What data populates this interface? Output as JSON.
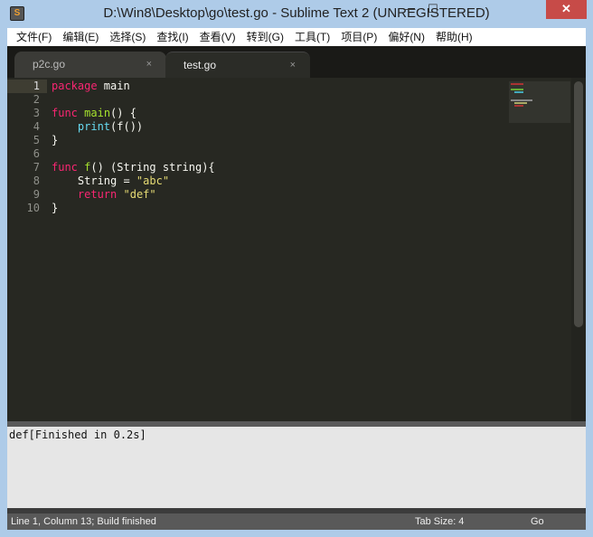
{
  "window": {
    "title": "D:\\Win8\\Desktop\\go\\test.go - Sublime Text 2 (UNREGISTERED)",
    "app_icon": "S",
    "minimize": "—",
    "maximize": "☐",
    "close": "✕"
  },
  "menu": [
    "文件(F)",
    "编辑(E)",
    "选择(S)",
    "查找(I)",
    "查看(V)",
    "转到(G)",
    "工具(T)",
    "项目(P)",
    "偏好(N)",
    "帮助(H)"
  ],
  "tabs": [
    {
      "label": "p2c.go",
      "close": "×"
    },
    {
      "label": "test.go",
      "close": "×"
    }
  ],
  "code": {
    "line_numbers": [
      "1",
      "2",
      "3",
      "4",
      "5",
      "6",
      "7",
      "8",
      "9",
      "10"
    ]
  },
  "output": {
    "text": "def[Finished in 0.2s]"
  },
  "status": {
    "position": "Line 1, Column 13; Build finished",
    "tab_size": "Tab Size: 4",
    "syntax": "Go"
  },
  "colors": {
    "keyword": "#f92672",
    "function": "#a6e22e",
    "builtin": "#66d9ef",
    "string": "#e6db74",
    "editor_bg": "#272822"
  }
}
